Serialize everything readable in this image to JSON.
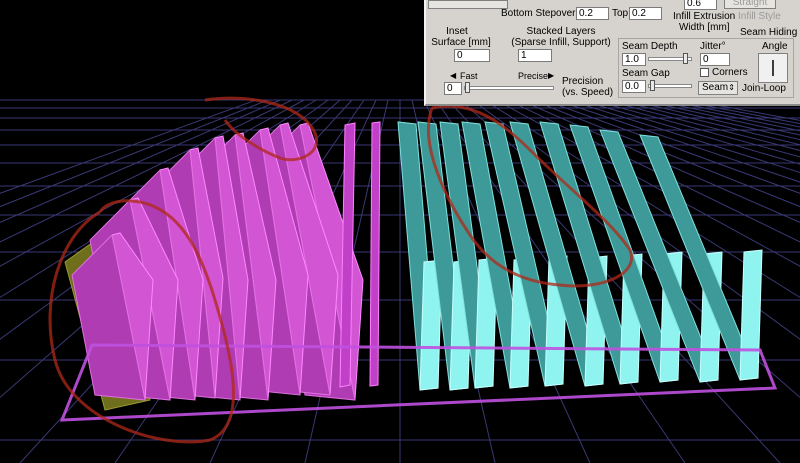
{
  "panel": {
    "top_row": {
      "bottom_stepover_label": "Bottom Stepover",
      "bottom_stepover_value": "0.2",
      "top_label": "Top",
      "top_value": "0.2",
      "infill_extrusion_width_value": "0.6",
      "infill_extrusion_label_line1": "Infill Extrusion",
      "infill_extrusion_label_line2": "Width [mm]",
      "infill_style_selected": "Straight",
      "infill_style_label": "Infill Style"
    },
    "inset": {
      "label_line1": "Inset",
      "label_line2": "Surface [mm]",
      "value": "0"
    },
    "stacked": {
      "label_line1": "Stacked Layers",
      "label_line2": "(Sparse Infill, Support)",
      "value": "1"
    },
    "precision": {
      "fast_label": "Fast",
      "precise_label": "Precise",
      "value": "0",
      "label_line1": "Precision",
      "label_line2": "(vs. Speed)"
    },
    "seam": {
      "hiding_label": "Seam Hiding",
      "depth_label": "Seam Depth",
      "depth_value": "1.0",
      "jitter_label": "Jitter°",
      "jitter_value": "0",
      "angle_label": "Angle",
      "gap_label": "Seam Gap",
      "gap_value": "0.0",
      "corners_label": "Corners",
      "mode_selected": "Seam",
      "join_label": "Join-Loop"
    }
  },
  "colors": {
    "background": "#000000",
    "grid": "#5a5aa8",
    "magenta": "#cc44cc",
    "cyan": "#5fd0cc",
    "olive": "#7a7a20",
    "bed_outline": "#c050e0",
    "annotation": "#a03020"
  }
}
